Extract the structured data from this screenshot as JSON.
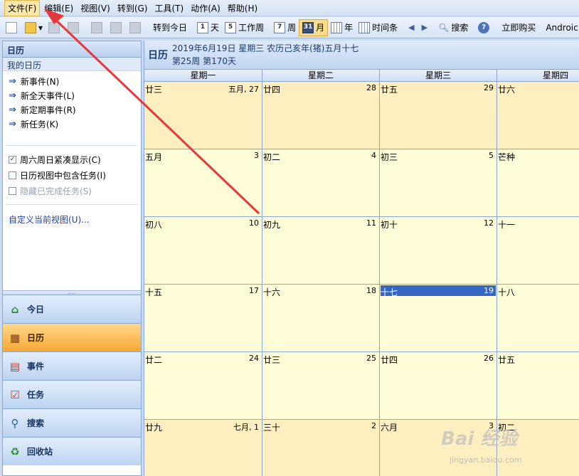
{
  "menubar": {
    "items": [
      "文件(F)",
      "编辑(E)",
      "视图(V)",
      "转到(G)",
      "工具(T)",
      "动作(A)",
      "帮助(H)"
    ]
  },
  "toolbar": {
    "goto_today": "转到今日",
    "day": "天",
    "day_icon": "1",
    "work_week": "工作周",
    "work_week_icon": "5",
    "week": "周",
    "week_icon": "7",
    "month": "月",
    "month_icon": "31",
    "year": "年",
    "timeline": "时间条",
    "search": "搜索",
    "buy_now": "立即购买",
    "android": "Androic"
  },
  "sidebar": {
    "header": "日历",
    "my_calendar": "我的日历",
    "actions": [
      "新事件(N)",
      "新全天事件(L)",
      "新定期事件(R)",
      "新任务(K)"
    ],
    "options": [
      {
        "label": "周六周日紧凑显示(C)",
        "checked": true,
        "disabled": false
      },
      {
        "label": "日历视图中包含任务(I)",
        "checked": false,
        "disabled": false
      },
      {
        "label": "隐藏已完成任务(S)",
        "checked": false,
        "disabled": true
      }
    ],
    "customize_link": "自定义当前视图(U)...",
    "nav": [
      {
        "label": "今日",
        "icon": "house-icon",
        "active": false
      },
      {
        "label": "日历",
        "icon": "calendar-icon",
        "active": true
      },
      {
        "label": "事件",
        "icon": "events-icon",
        "active": false
      },
      {
        "label": "任务",
        "icon": "tasks-icon",
        "active": false
      },
      {
        "label": "搜索",
        "icon": "search-icon",
        "active": false
      },
      {
        "label": "回收站",
        "icon": "recycle-icon",
        "active": false
      }
    ]
  },
  "calendar": {
    "title": "日历",
    "date_line": "2019年6月19日 星期三 农历己亥年(猪)五月十七",
    "week_line": "第25周 第170天",
    "weekdays": [
      "星期一",
      "星期二",
      "星期三",
      "星期四"
    ],
    "weeks": [
      [
        {
          "lunar": "廿三",
          "num": "五月, 27",
          "prev": true
        },
        {
          "lunar": "廿四",
          "num": "28",
          "prev": true
        },
        {
          "lunar": "廿五",
          "num": "29",
          "prev": true
        },
        {
          "lunar": "廿六",
          "num": "",
          "prev": true
        }
      ],
      [
        {
          "lunar": "五月",
          "num": "3"
        },
        {
          "lunar": "初二",
          "num": "4"
        },
        {
          "lunar": "初三",
          "num": "5"
        },
        {
          "lunar": "芒种",
          "num": ""
        }
      ],
      [
        {
          "lunar": "初八",
          "num": "10"
        },
        {
          "lunar": "初九",
          "num": "11"
        },
        {
          "lunar": "初十",
          "num": "12"
        },
        {
          "lunar": "十一",
          "num": ""
        }
      ],
      [
        {
          "lunar": "十五",
          "num": "17"
        },
        {
          "lunar": "十六",
          "num": "18"
        },
        {
          "lunar": "十七",
          "num": "19",
          "today": true
        },
        {
          "lunar": "十八",
          "num": ""
        }
      ],
      [
        {
          "lunar": "廿二",
          "num": "24"
        },
        {
          "lunar": "廿三",
          "num": "25"
        },
        {
          "lunar": "廿四",
          "num": "26"
        },
        {
          "lunar": "廿五",
          "num": ""
        }
      ],
      [
        {
          "lunar": "廿九",
          "num": "七月, 1",
          "next": true
        },
        {
          "lunar": "三十",
          "num": "2",
          "next": true
        },
        {
          "lunar": "六月",
          "num": "3",
          "next": true
        },
        {
          "lunar": "初二",
          "num": "",
          "next": true
        }
      ]
    ]
  },
  "watermark": {
    "text": "Bai 经验",
    "sub": "jingyan.baidu.com"
  },
  "colors": {
    "today": "#3566c4",
    "month_bg": "#fffcd8",
    "other_month_bg": "#ffefc0",
    "annotation": "#e8373a"
  }
}
